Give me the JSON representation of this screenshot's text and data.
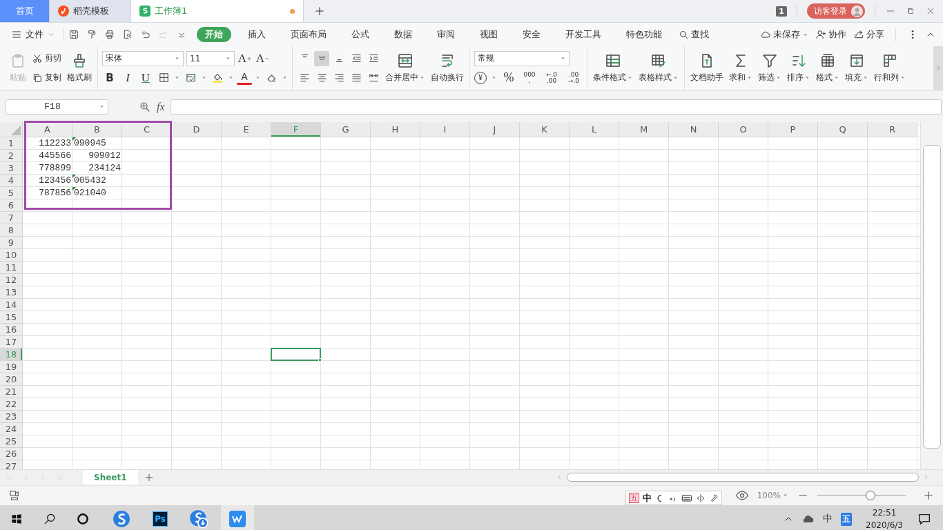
{
  "title_bar": {
    "tabs": [
      {
        "label": "首页",
        "kind": "home",
        "selected": false,
        "modified": false
      },
      {
        "label": "稻壳模板",
        "kind": "docer",
        "selected": false,
        "modified": false
      },
      {
        "label": "工作簿1",
        "kind": "sheet",
        "selected": true,
        "modified": true
      }
    ],
    "window_count": "1",
    "login": "访客登录"
  },
  "menu_bar": {
    "file": "文件",
    "quick_tools": [
      {
        "kind": "save",
        "disabled": false
      },
      {
        "kind": "painter",
        "disabled": false
      },
      {
        "kind": "print",
        "disabled": false
      },
      {
        "kind": "preview",
        "disabled": false
      },
      {
        "kind": "undo",
        "disabled": false
      },
      {
        "kind": "redo",
        "disabled": true
      },
      {
        "kind": "customize",
        "disabled": false
      }
    ],
    "tabs": [
      {
        "label": "开始",
        "selected": true
      },
      {
        "label": "插入",
        "selected": false
      },
      {
        "label": "页面布局",
        "selected": false
      },
      {
        "label": "公式",
        "selected": false
      },
      {
        "label": "数据",
        "selected": false
      },
      {
        "label": "审阅",
        "selected": false
      },
      {
        "label": "视图",
        "selected": false
      },
      {
        "label": "安全",
        "selected": false
      },
      {
        "label": "开发工具",
        "selected": false
      },
      {
        "label": "特色功能",
        "selected": false
      }
    ],
    "search": "查找",
    "right": [
      {
        "kind": "unsaved",
        "label": "未保存",
        "dropdown": true
      },
      {
        "kind": "collab",
        "label": "协作",
        "dropdown": false
      },
      {
        "kind": "share",
        "label": "分享",
        "dropdown": false
      }
    ]
  },
  "ribbon": {
    "clipboard": [
      {
        "kind": "paste",
        "label": "粘贴",
        "disabled": true
      },
      {
        "kind": "cut",
        "label": "剪切",
        "disabled": false
      },
      {
        "kind": "copy",
        "label": "复制",
        "disabled": false
      },
      {
        "kind": "format-painter",
        "label": "格式刷",
        "disabled": false
      }
    ],
    "font": {
      "name": "宋体",
      "size": "11",
      "buttons": [
        {
          "kind": "grow",
          "glyph": "A"
        },
        {
          "kind": "shrink",
          "glyph": "A"
        },
        {
          "kind": "bold",
          "glyph": "B"
        },
        {
          "kind": "italic",
          "glyph": "I"
        },
        {
          "kind": "underline",
          "glyph": "U"
        },
        {
          "kind": "border"
        },
        {
          "kind": "cell-style"
        },
        {
          "kind": "fill-color"
        },
        {
          "kind": "font-color",
          "glyph": "A"
        },
        {
          "kind": "clear"
        }
      ]
    },
    "alignment": {
      "buttons": [
        {
          "kind": "top",
          "selected": false
        },
        {
          "kind": "middle",
          "selected": true
        },
        {
          "kind": "bottom",
          "selected": false
        },
        {
          "kind": "outdent",
          "selected": false
        },
        {
          "kind": "indent",
          "selected": false
        },
        {
          "kind": "left",
          "selected": false
        },
        {
          "kind": "center",
          "selected": false
        },
        {
          "kind": "right",
          "selected": false
        },
        {
          "kind": "justify",
          "selected": false
        },
        {
          "kind": "distribute",
          "selected": false
        }
      ],
      "large": [
        {
          "kind": "merge",
          "label": "合并居中",
          "dropdown": true
        },
        {
          "kind": "wrap",
          "label": "自动换行",
          "dropdown": false
        }
      ]
    },
    "number": {
      "format": "常规",
      "buttons": [
        {
          "kind": "currency",
          "lines": [
            "¥"
          ]
        },
        {
          "kind": "percent",
          "lines": [
            "%"
          ]
        },
        {
          "kind": "thousands",
          "lines": [
            "000",
            ","
          ]
        },
        {
          "kind": "add-decimal",
          "lines": [
            "←.0",
            ".00"
          ]
        },
        {
          "kind": "remove-decimal",
          "lines": [
            ".00",
            "→.0"
          ]
        }
      ]
    },
    "styles": [
      {
        "kind": "conditional",
        "label": "条件格式",
        "dropdown": true
      },
      {
        "kind": "table-style",
        "label": "表格样式",
        "dropdown": true
      }
    ],
    "tools": [
      {
        "kind": "doc-helper",
        "label": "文档助手",
        "dropdown": false
      },
      {
        "kind": "sum",
        "label": "求和",
        "dropdown": true
      },
      {
        "kind": "filter",
        "label": "筛选",
        "dropdown": true
      },
      {
        "kind": "sort",
        "label": "排序",
        "dropdown": true
      },
      {
        "kind": "format",
        "label": "格式",
        "dropdown": true
      },
      {
        "kind": "fill",
        "label": "填充",
        "dropdown": true
      },
      {
        "kind": "rows-cols",
        "label": "行和列",
        "dropdown": true
      }
    ]
  },
  "formula_bar": {
    "name_box": "F18",
    "fx": "fx"
  },
  "sheet": {
    "frame_around_data": true,
    "columns": [
      {
        "label": "A",
        "selected": false
      },
      {
        "label": "B",
        "selected": false
      },
      {
        "label": "C",
        "selected": false
      },
      {
        "label": "D",
        "selected": false
      },
      {
        "label": "E",
        "selected": false
      },
      {
        "label": "F",
        "selected": true
      },
      {
        "label": "G",
        "selected": false
      },
      {
        "label": "H",
        "selected": false
      },
      {
        "label": "I",
        "selected": false
      },
      {
        "label": "J",
        "selected": false
      },
      {
        "label": "K",
        "selected": false
      },
      {
        "label": "L",
        "selected": false
      },
      {
        "label": "M",
        "selected": false
      },
      {
        "label": "N",
        "selected": false
      },
      {
        "label": "O",
        "selected": false
      },
      {
        "label": "P",
        "selected": false
      },
      {
        "label": "Q",
        "selected": false
      },
      {
        "label": "R",
        "selected": false
      }
    ],
    "rows": [
      {
        "label": "1",
        "selected": false,
        "cells": [
          {
            "value": "112233",
            "kind": "number"
          },
          {
            "value": "090945",
            "kind": "text"
          }
        ]
      },
      {
        "label": "2",
        "selected": false,
        "cells": [
          {
            "value": "445566",
            "kind": "number"
          },
          {
            "value": "909012",
            "kind": "number"
          }
        ]
      },
      {
        "label": "3",
        "selected": false,
        "cells": [
          {
            "value": "778899",
            "kind": "number"
          },
          {
            "value": "234124",
            "kind": "number"
          }
        ]
      },
      {
        "label": "4",
        "selected": false,
        "cells": [
          {
            "value": "123456",
            "kind": "number"
          },
          {
            "value": "005432",
            "kind": "text"
          }
        ]
      },
      {
        "label": "5",
        "selected": false,
        "cells": [
          {
            "value": "787856",
            "kind": "number"
          },
          {
            "value": "021040",
            "kind": "text"
          }
        ]
      },
      {
        "label": "6",
        "selected": false
      },
      {
        "label": "7",
        "selected": false
      },
      {
        "label": "8",
        "selected": false
      },
      {
        "label": "9",
        "selected": false
      },
      {
        "label": "10",
        "selected": false
      },
      {
        "label": "11",
        "selected": false
      },
      {
        "label": "12",
        "selected": false
      },
      {
        "label": "13",
        "selected": false
      },
      {
        "label": "14",
        "selected": false
      },
      {
        "label": "15",
        "selected": false
      },
      {
        "label": "16",
        "selected": false
      },
      {
        "label": "17",
        "selected": false
      },
      {
        "label": "18",
        "selected": true
      },
      {
        "label": "19",
        "selected": false
      },
      {
        "label": "20",
        "selected": false
      },
      {
        "label": "21",
        "selected": false
      },
      {
        "label": "22",
        "selected": false
      },
      {
        "label": "23",
        "selected": false
      },
      {
        "label": "24",
        "selected": false
      },
      {
        "label": "25",
        "selected": false
      },
      {
        "label": "26",
        "selected": false
      },
      {
        "label": "27",
        "selected": false
      }
    ]
  },
  "sheet_tabs": [
    {
      "label": "Sheet1",
      "selected": true
    }
  ],
  "status_bar": {
    "ime_toolbar": [
      "五",
      "中"
    ],
    "zoom": {
      "label": "100%",
      "level": 0.6
    }
  },
  "taskbar": {
    "apps": [
      {
        "kind": "sogou",
        "active": false
      },
      {
        "kind": "photoshop",
        "label": "Ps",
        "active": false
      },
      {
        "kind": "sogou-download",
        "active": false
      },
      {
        "kind": "wps",
        "active": true
      }
    ],
    "tray_ime": "中",
    "tray_input": "五",
    "time": "22:51",
    "date": "2020/6/3"
  }
}
